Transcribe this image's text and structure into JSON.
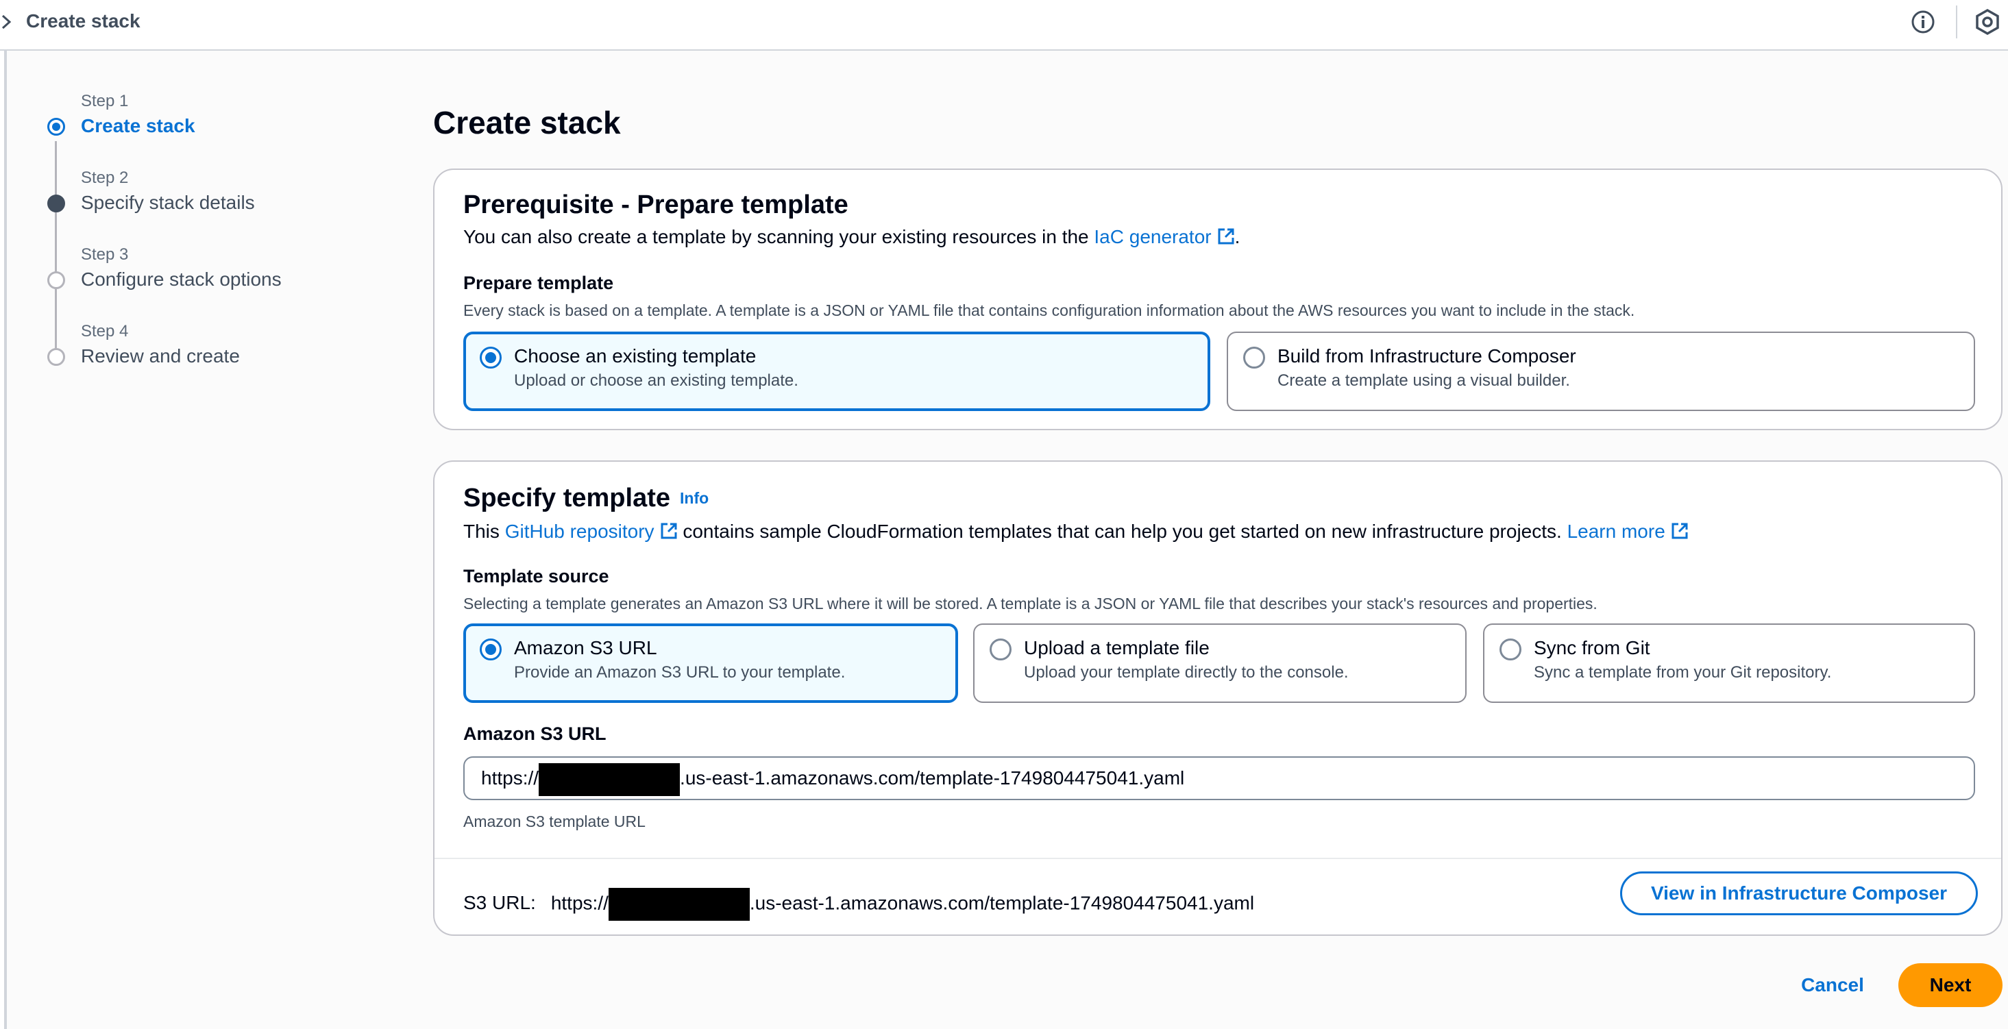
{
  "topbar": {
    "breadcrumb": "Create stack",
    "icons": [
      "chevron-right-icon",
      "info-icon",
      "settings-icon"
    ]
  },
  "steps": [
    {
      "number": "Step 1",
      "title": "Create stack",
      "state": "current"
    },
    {
      "number": "Step 2",
      "title": "Specify stack details",
      "state": "filled"
    },
    {
      "number": "Step 3",
      "title": "Configure stack options",
      "state": "upcoming"
    },
    {
      "number": "Step 4",
      "title": "Review and create",
      "state": "upcoming"
    }
  ],
  "page": {
    "title": "Create stack"
  },
  "prerequisite": {
    "heading": "Prerequisite - Prepare template",
    "desc_prefix": "You can also create a template by scanning your existing resources in the ",
    "desc_link": "IaC generator",
    "desc_suffix": ".",
    "field_label": "Prepare template",
    "field_hint": "Every stack is based on a template. A template is a JSON or YAML file that contains configuration information about the AWS resources you want to include in the stack.",
    "options": [
      {
        "title": "Choose an existing template",
        "desc": "Upload or choose an existing template.",
        "selected": true
      },
      {
        "title": "Build from Infrastructure Composer",
        "desc": "Create a template using a visual builder.",
        "selected": false
      }
    ]
  },
  "specify": {
    "heading": "Specify template",
    "info": "Info",
    "desc_prefix": "This ",
    "desc_link1": "GitHub repository",
    "desc_middle": " contains sample CloudFormation templates that can help you get started on new infrastructure projects. ",
    "desc_link2": "Learn more",
    "field_label": "Template source",
    "field_hint": "Selecting a template generates an Amazon S3 URL where it will be stored. A template is a JSON or YAML file that describes your stack's resources and properties.",
    "options": [
      {
        "title": "Amazon S3 URL",
        "desc": "Provide an Amazon S3 URL to your template.",
        "selected": true
      },
      {
        "title": "Upload a template file",
        "desc": "Upload your template directly to the console.",
        "selected": false
      },
      {
        "title": "Sync from Git",
        "desc": "Sync a template from your Git repository.",
        "selected": false
      }
    ],
    "url_label": "Amazon S3 URL",
    "url_prefix": "https://",
    "url_suffix": ".us-east-1.amazonaws.com/template-1749804475041.yaml",
    "url_constraint": "Amazon S3 template URL",
    "s3_key": "S3 URL:",
    "s3_prefix": "https://",
    "s3_suffix": ".us-east-1.amazonaws.com/template-1749804475041.yaml",
    "view_button": "View in Infrastructure Composer"
  },
  "footer": {
    "cancel": "Cancel",
    "next": "Next"
  },
  "colors": {
    "link": "#0972d3",
    "primary_button": "#ff9900",
    "selected_tile_bg": "#f0fbff"
  }
}
